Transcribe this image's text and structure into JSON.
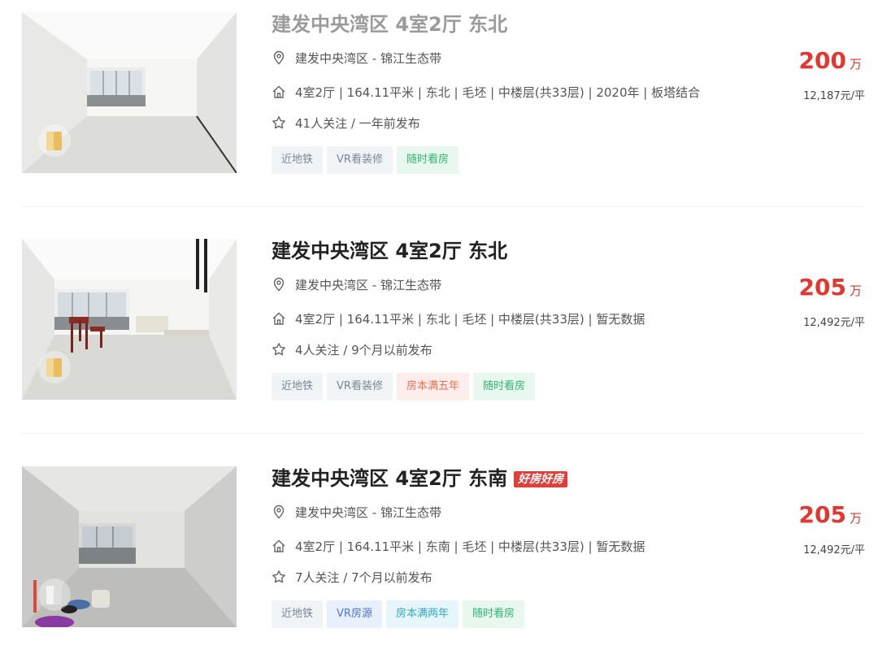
{
  "colors": {
    "price": "#e2362e",
    "good_house_tag": "#e0403a",
    "tag_green": "#2fb673",
    "tag_gray": "#7a8794",
    "tag_blue": "#4b74d9",
    "tag_cyan": "#35a9c5",
    "tag_red": "#f0704f"
  },
  "icons": {
    "location": "location-pin-icon",
    "house": "house-icon",
    "follow": "star-icon",
    "vr": "vr-badge-icon"
  },
  "listings": [
    {
      "title": "建发中央湾区 4室2厅 东北",
      "badge": "",
      "community": "建发中央湾区",
      "separator": " - ",
      "area": "锦江生态带",
      "house_info": "4室2厅 | 164.11平米 | 东北 | 毛坯 | 中楼层(共33层) | 2020年 | 板塔结合",
      "follow_info": "41人关注 / 一年前发布",
      "tags": [
        "近地铁",
        "VR看装修",
        "随时看房"
      ],
      "price": "200",
      "price_unit": "万",
      "unit_price": "12,187元/平"
    },
    {
      "title": "建发中央湾区 4室2厅 东北",
      "badge": "",
      "community": "建发中央湾区",
      "separator": " - ",
      "area": "锦江生态带",
      "house_info": "4室2厅 | 164.11平米 | 东北 | 毛坯 | 中楼层(共33层) | 暂无数据",
      "follow_info": "4人关注 / 9个月以前发布",
      "tags": [
        "近地铁",
        "VR看装修",
        "房本满五年",
        "随时看房"
      ],
      "price": "205",
      "price_unit": "万",
      "unit_price": "12,492元/平"
    },
    {
      "title": "建发中央湾区 4室2厅 东南",
      "badge": "好房好房",
      "community": "建发中央湾区",
      "separator": " - ",
      "area": "锦江生态带",
      "house_info": "4室2厅 | 164.11平米 | 东南 | 毛坯 | 中楼层(共33层) | 暂无数据",
      "follow_info": "7人关注 / 7个月以前发布",
      "tags": [
        "近地铁",
        "VR房源",
        "房本满两年",
        "随时看房"
      ],
      "price": "205",
      "price_unit": "万",
      "unit_price": "12,492元/平"
    }
  ]
}
